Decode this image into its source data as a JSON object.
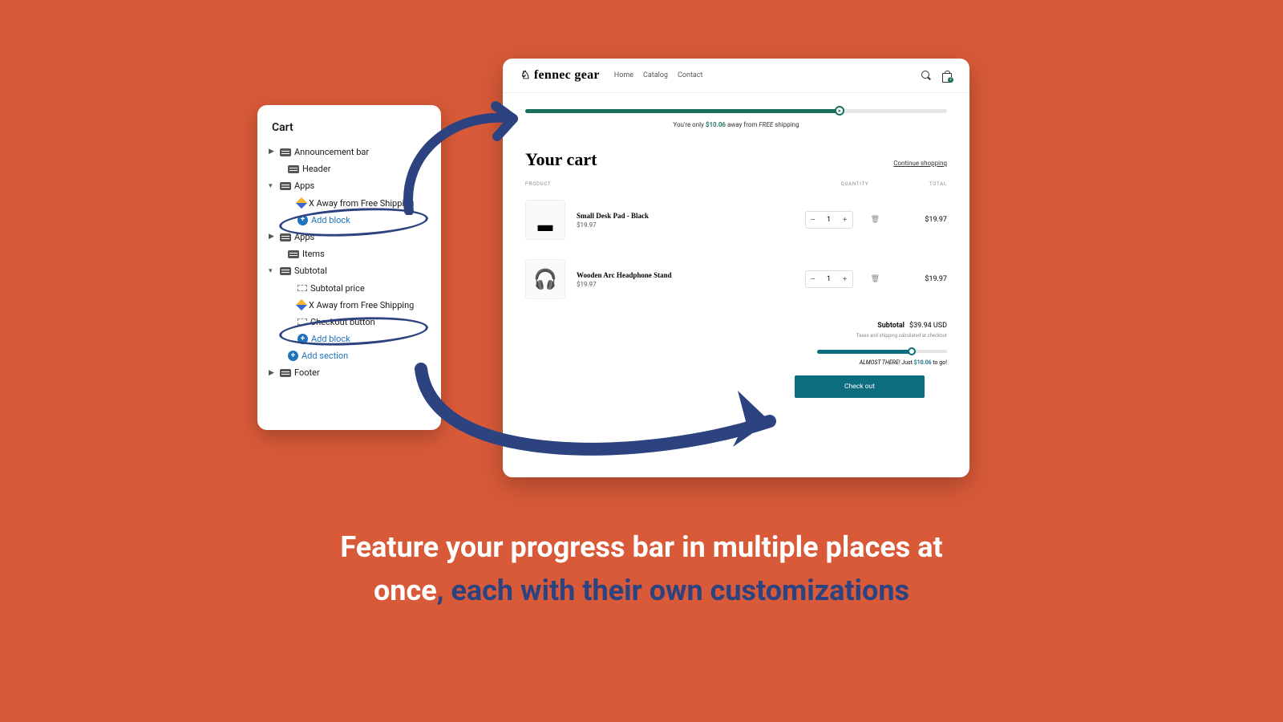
{
  "sidebar": {
    "title": "Cart",
    "rows": [
      {
        "label": "Announcement bar"
      },
      {
        "label": "Header"
      },
      {
        "label": "Apps"
      },
      {
        "label": "X Away from Free Shipping"
      },
      {
        "label": "Add block"
      },
      {
        "label": "Apps"
      },
      {
        "label": "Items"
      },
      {
        "label": "Subtotal"
      },
      {
        "label": "Subtotal price"
      },
      {
        "label": "X Away from Free Shipping"
      },
      {
        "label": "Checkout button"
      },
      {
        "label": "Add block"
      },
      {
        "label": "Add section"
      },
      {
        "label": "Footer"
      }
    ]
  },
  "store": {
    "brand": "fennec gear",
    "nav": {
      "home": "Home",
      "catalog": "Catalog",
      "contact": "Contact"
    },
    "bag_count": "2",
    "progress1": {
      "pre": "You're only ",
      "amount": "$10.06",
      "mid": " away from ",
      "em": "FREE",
      "post": " shipping"
    },
    "cart_title": "Your cart",
    "continue": "Continue shopping",
    "cols": {
      "product": "PRODUCT",
      "qty": "QUANTITY",
      "total": "TOTAL"
    },
    "items": [
      {
        "title": "Small Desk Pad - Black",
        "price": "$19.97",
        "qty": "1",
        "total": "$19.97",
        "glyph": "▂"
      },
      {
        "title": "Wooden Arc Headphone Stand",
        "price": "$19.97",
        "qty": "1",
        "total": "$19.97",
        "glyph": "🎧"
      }
    ],
    "subtotal_label": "Subtotal",
    "subtotal": "$39.94 USD",
    "taxnote": "Taxes and shipping calculated at checkout",
    "progress2": {
      "pre": "ALMOST THERE!",
      "mid": " Just ",
      "amount": "$10.06",
      "post": " to go!"
    },
    "checkout": "Check out"
  },
  "headline": {
    "l1": "Feature your progress bar in multiple places at",
    "l2a": "once",
    "l2b": ", ",
    "l2c": "each with their own customizations"
  }
}
